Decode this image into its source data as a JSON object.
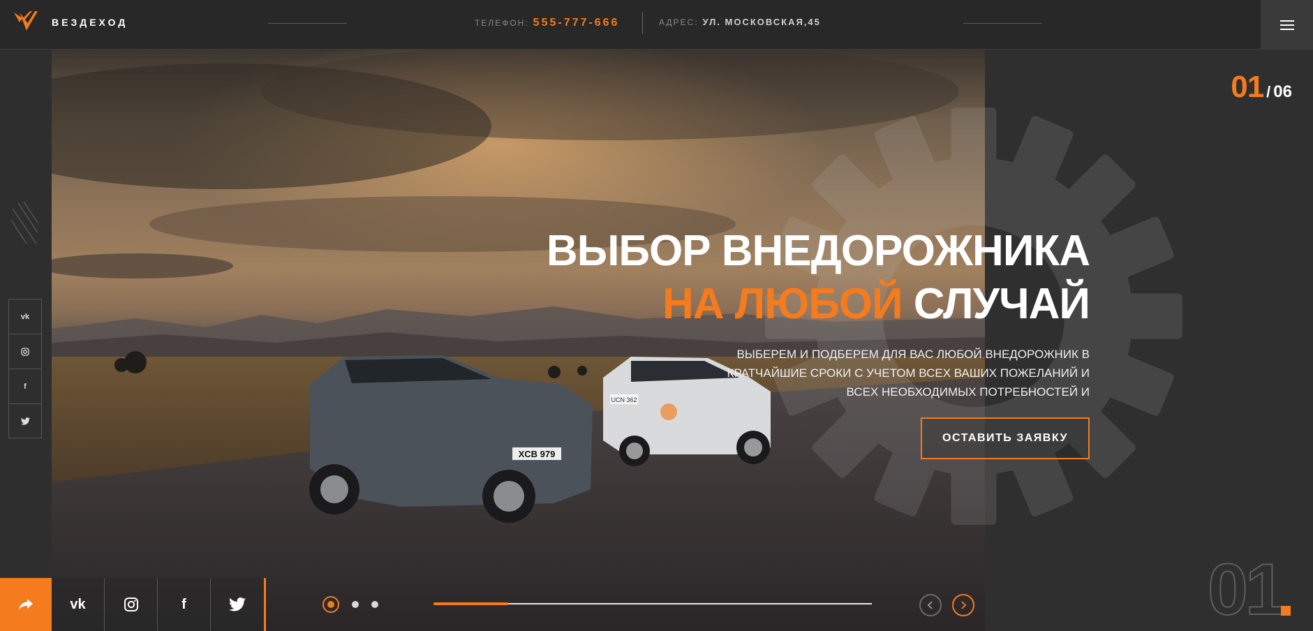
{
  "header": {
    "brand": "ВЕЗДЕХОД",
    "phone_label": "ТЕЛЕФОН:",
    "phone_value": "555-777-666",
    "address_label": "АДРЕС:",
    "address_value": "УЛ. МОСКОВСКАЯ,45",
    "menu_icon": "hamburger-icon"
  },
  "hero": {
    "title_line1": "ВЫБОР ВНЕДОРОЖНИКА",
    "title_accent": "НА ЛЮБОЙ",
    "title_rest": " СЛУЧАЙ",
    "subtext": "ВЫБЕРЕМ И ПОДБЕРЕМ ДЛЯ ВАС ЛЮБОЙ ВНЕДОРОЖНИК В КРАТЧАЙШИЕ СРОКИ С УЧЕТОМ ВСЕХ ВАШИХ ПОЖЕЛАНИЙ И ВСЕХ НЕОБХОДИМЫХ ПОТРЕБНОСТЕЙ И",
    "cta_label": "ОСТАВИТЬ ЗАЯВКУ",
    "plate_front": "XCB 979",
    "plate_rear": "UCN 362"
  },
  "slider": {
    "current": "01",
    "separator": "/",
    "total": "06",
    "big_number": "01",
    "progress_fraction": 0.17,
    "dots": [
      {
        "active": true
      },
      {
        "active": false
      },
      {
        "active": false
      }
    ]
  },
  "social_vertical": [
    {
      "label": "vk",
      "icon": "vk-icon"
    },
    {
      "label": "◎",
      "icon": "instagram-icon"
    },
    {
      "label": "f",
      "icon": "facebook-icon"
    },
    {
      "label": "🐦",
      "icon": "twitter-icon"
    }
  ],
  "social_bottom": [
    {
      "label": "vk",
      "icon": "vk-icon"
    },
    {
      "label": "◎",
      "icon": "instagram-icon"
    },
    {
      "label": "f",
      "icon": "facebook-icon"
    },
    {
      "label": "🐦",
      "icon": "twitter-icon"
    }
  ],
  "colors": {
    "accent": "#f47b1e",
    "background": "#2b2b2b",
    "header": "#282828"
  }
}
